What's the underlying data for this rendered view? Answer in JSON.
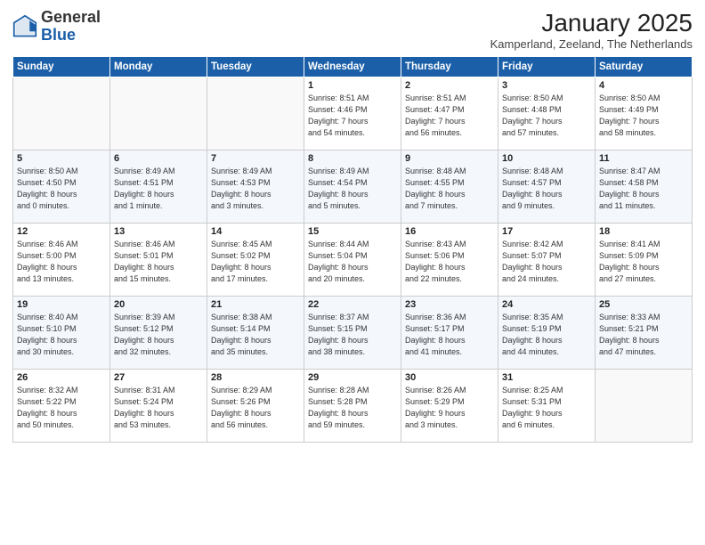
{
  "header": {
    "logo_general": "General",
    "logo_blue": "Blue",
    "month_year": "January 2025",
    "location": "Kamperland, Zeeland, The Netherlands"
  },
  "days_of_week": [
    "Sunday",
    "Monday",
    "Tuesday",
    "Wednesday",
    "Thursday",
    "Friday",
    "Saturday"
  ],
  "weeks": [
    [
      {
        "day": "",
        "info": ""
      },
      {
        "day": "",
        "info": ""
      },
      {
        "day": "",
        "info": ""
      },
      {
        "day": "1",
        "info": "Sunrise: 8:51 AM\nSunset: 4:46 PM\nDaylight: 7 hours\nand 54 minutes."
      },
      {
        "day": "2",
        "info": "Sunrise: 8:51 AM\nSunset: 4:47 PM\nDaylight: 7 hours\nand 56 minutes."
      },
      {
        "day": "3",
        "info": "Sunrise: 8:50 AM\nSunset: 4:48 PM\nDaylight: 7 hours\nand 57 minutes."
      },
      {
        "day": "4",
        "info": "Sunrise: 8:50 AM\nSunset: 4:49 PM\nDaylight: 7 hours\nand 58 minutes."
      }
    ],
    [
      {
        "day": "5",
        "info": "Sunrise: 8:50 AM\nSunset: 4:50 PM\nDaylight: 8 hours\nand 0 minutes."
      },
      {
        "day": "6",
        "info": "Sunrise: 8:49 AM\nSunset: 4:51 PM\nDaylight: 8 hours\nand 1 minute."
      },
      {
        "day": "7",
        "info": "Sunrise: 8:49 AM\nSunset: 4:53 PM\nDaylight: 8 hours\nand 3 minutes."
      },
      {
        "day": "8",
        "info": "Sunrise: 8:49 AM\nSunset: 4:54 PM\nDaylight: 8 hours\nand 5 minutes."
      },
      {
        "day": "9",
        "info": "Sunrise: 8:48 AM\nSunset: 4:55 PM\nDaylight: 8 hours\nand 7 minutes."
      },
      {
        "day": "10",
        "info": "Sunrise: 8:48 AM\nSunset: 4:57 PM\nDaylight: 8 hours\nand 9 minutes."
      },
      {
        "day": "11",
        "info": "Sunrise: 8:47 AM\nSunset: 4:58 PM\nDaylight: 8 hours\nand 11 minutes."
      }
    ],
    [
      {
        "day": "12",
        "info": "Sunrise: 8:46 AM\nSunset: 5:00 PM\nDaylight: 8 hours\nand 13 minutes."
      },
      {
        "day": "13",
        "info": "Sunrise: 8:46 AM\nSunset: 5:01 PM\nDaylight: 8 hours\nand 15 minutes."
      },
      {
        "day": "14",
        "info": "Sunrise: 8:45 AM\nSunset: 5:02 PM\nDaylight: 8 hours\nand 17 minutes."
      },
      {
        "day": "15",
        "info": "Sunrise: 8:44 AM\nSunset: 5:04 PM\nDaylight: 8 hours\nand 20 minutes."
      },
      {
        "day": "16",
        "info": "Sunrise: 8:43 AM\nSunset: 5:06 PM\nDaylight: 8 hours\nand 22 minutes."
      },
      {
        "day": "17",
        "info": "Sunrise: 8:42 AM\nSunset: 5:07 PM\nDaylight: 8 hours\nand 24 minutes."
      },
      {
        "day": "18",
        "info": "Sunrise: 8:41 AM\nSunset: 5:09 PM\nDaylight: 8 hours\nand 27 minutes."
      }
    ],
    [
      {
        "day": "19",
        "info": "Sunrise: 8:40 AM\nSunset: 5:10 PM\nDaylight: 8 hours\nand 30 minutes."
      },
      {
        "day": "20",
        "info": "Sunrise: 8:39 AM\nSunset: 5:12 PM\nDaylight: 8 hours\nand 32 minutes."
      },
      {
        "day": "21",
        "info": "Sunrise: 8:38 AM\nSunset: 5:14 PM\nDaylight: 8 hours\nand 35 minutes."
      },
      {
        "day": "22",
        "info": "Sunrise: 8:37 AM\nSunset: 5:15 PM\nDaylight: 8 hours\nand 38 minutes."
      },
      {
        "day": "23",
        "info": "Sunrise: 8:36 AM\nSunset: 5:17 PM\nDaylight: 8 hours\nand 41 minutes."
      },
      {
        "day": "24",
        "info": "Sunrise: 8:35 AM\nSunset: 5:19 PM\nDaylight: 8 hours\nand 44 minutes."
      },
      {
        "day": "25",
        "info": "Sunrise: 8:33 AM\nSunset: 5:21 PM\nDaylight: 8 hours\nand 47 minutes."
      }
    ],
    [
      {
        "day": "26",
        "info": "Sunrise: 8:32 AM\nSunset: 5:22 PM\nDaylight: 8 hours\nand 50 minutes."
      },
      {
        "day": "27",
        "info": "Sunrise: 8:31 AM\nSunset: 5:24 PM\nDaylight: 8 hours\nand 53 minutes."
      },
      {
        "day": "28",
        "info": "Sunrise: 8:29 AM\nSunset: 5:26 PM\nDaylight: 8 hours\nand 56 minutes."
      },
      {
        "day": "29",
        "info": "Sunrise: 8:28 AM\nSunset: 5:28 PM\nDaylight: 8 hours\nand 59 minutes."
      },
      {
        "day": "30",
        "info": "Sunrise: 8:26 AM\nSunset: 5:29 PM\nDaylight: 9 hours\nand 3 minutes."
      },
      {
        "day": "31",
        "info": "Sunrise: 8:25 AM\nSunset: 5:31 PM\nDaylight: 9 hours\nand 6 minutes."
      },
      {
        "day": "",
        "info": ""
      }
    ]
  ]
}
